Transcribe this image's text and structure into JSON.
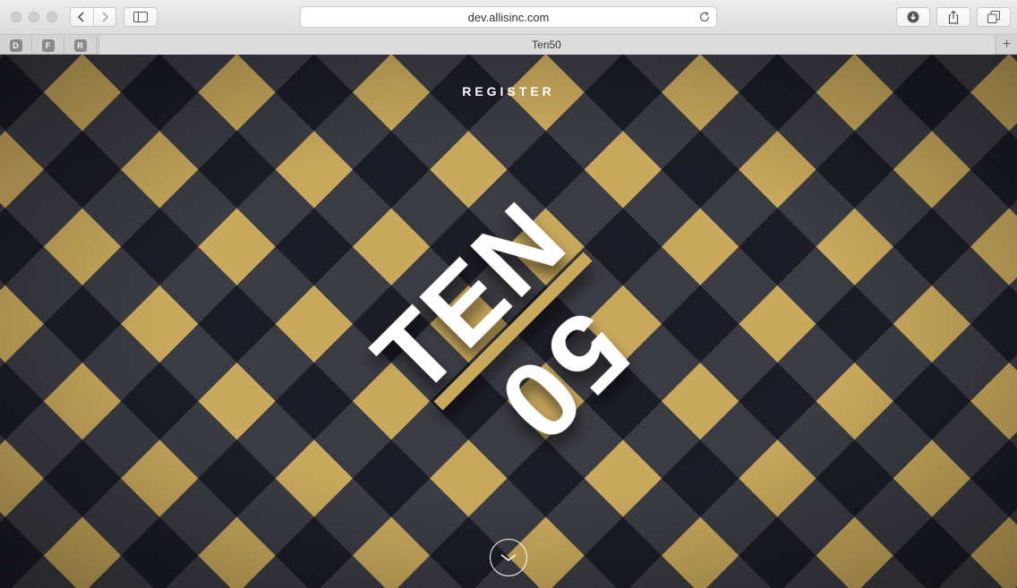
{
  "browser": {
    "address": "dev.allisinc.com",
    "tab_title": "Ten50",
    "favorites": [
      "D",
      "F",
      "R"
    ],
    "new_tab_symbol": "+"
  },
  "page": {
    "register_label": "REGISTER",
    "logo": {
      "word": "TEN",
      "number": "50",
      "accent_color": "#c9a95c"
    },
    "colors": {
      "gold": "#c9a95c",
      "dark": "#1c1d25",
      "mid": "#3a3b42"
    }
  }
}
